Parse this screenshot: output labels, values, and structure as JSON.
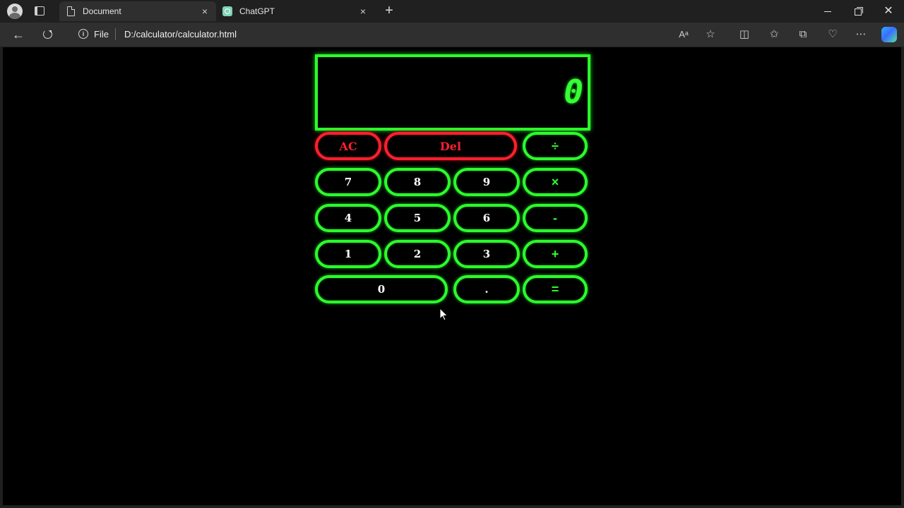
{
  "browser": {
    "tabs": [
      {
        "label": "Document",
        "icon": "document-icon",
        "active": true
      },
      {
        "label": "ChatGPT",
        "icon": "chatgpt-icon",
        "active": false
      }
    ],
    "new_tab_label": "+",
    "close_label": "×",
    "address": {
      "scheme_label": "File",
      "url": "D:/calculator/calculator.html"
    }
  },
  "calculator": {
    "display_value": "0",
    "keys": {
      "ac": "AC",
      "del": "Del",
      "divide": "÷",
      "seven": "7",
      "eight": "8",
      "nine": "9",
      "multiply": "×",
      "four": "4",
      "five": "5",
      "six": "6",
      "minus": "-",
      "one": "1",
      "two": "2",
      "three": "3",
      "plus": "+",
      "zero": "0",
      "dot": ".",
      "equals": "="
    },
    "colors": {
      "accent": "#2bff2b",
      "danger": "#ff1f2e",
      "background": "#000000"
    }
  }
}
